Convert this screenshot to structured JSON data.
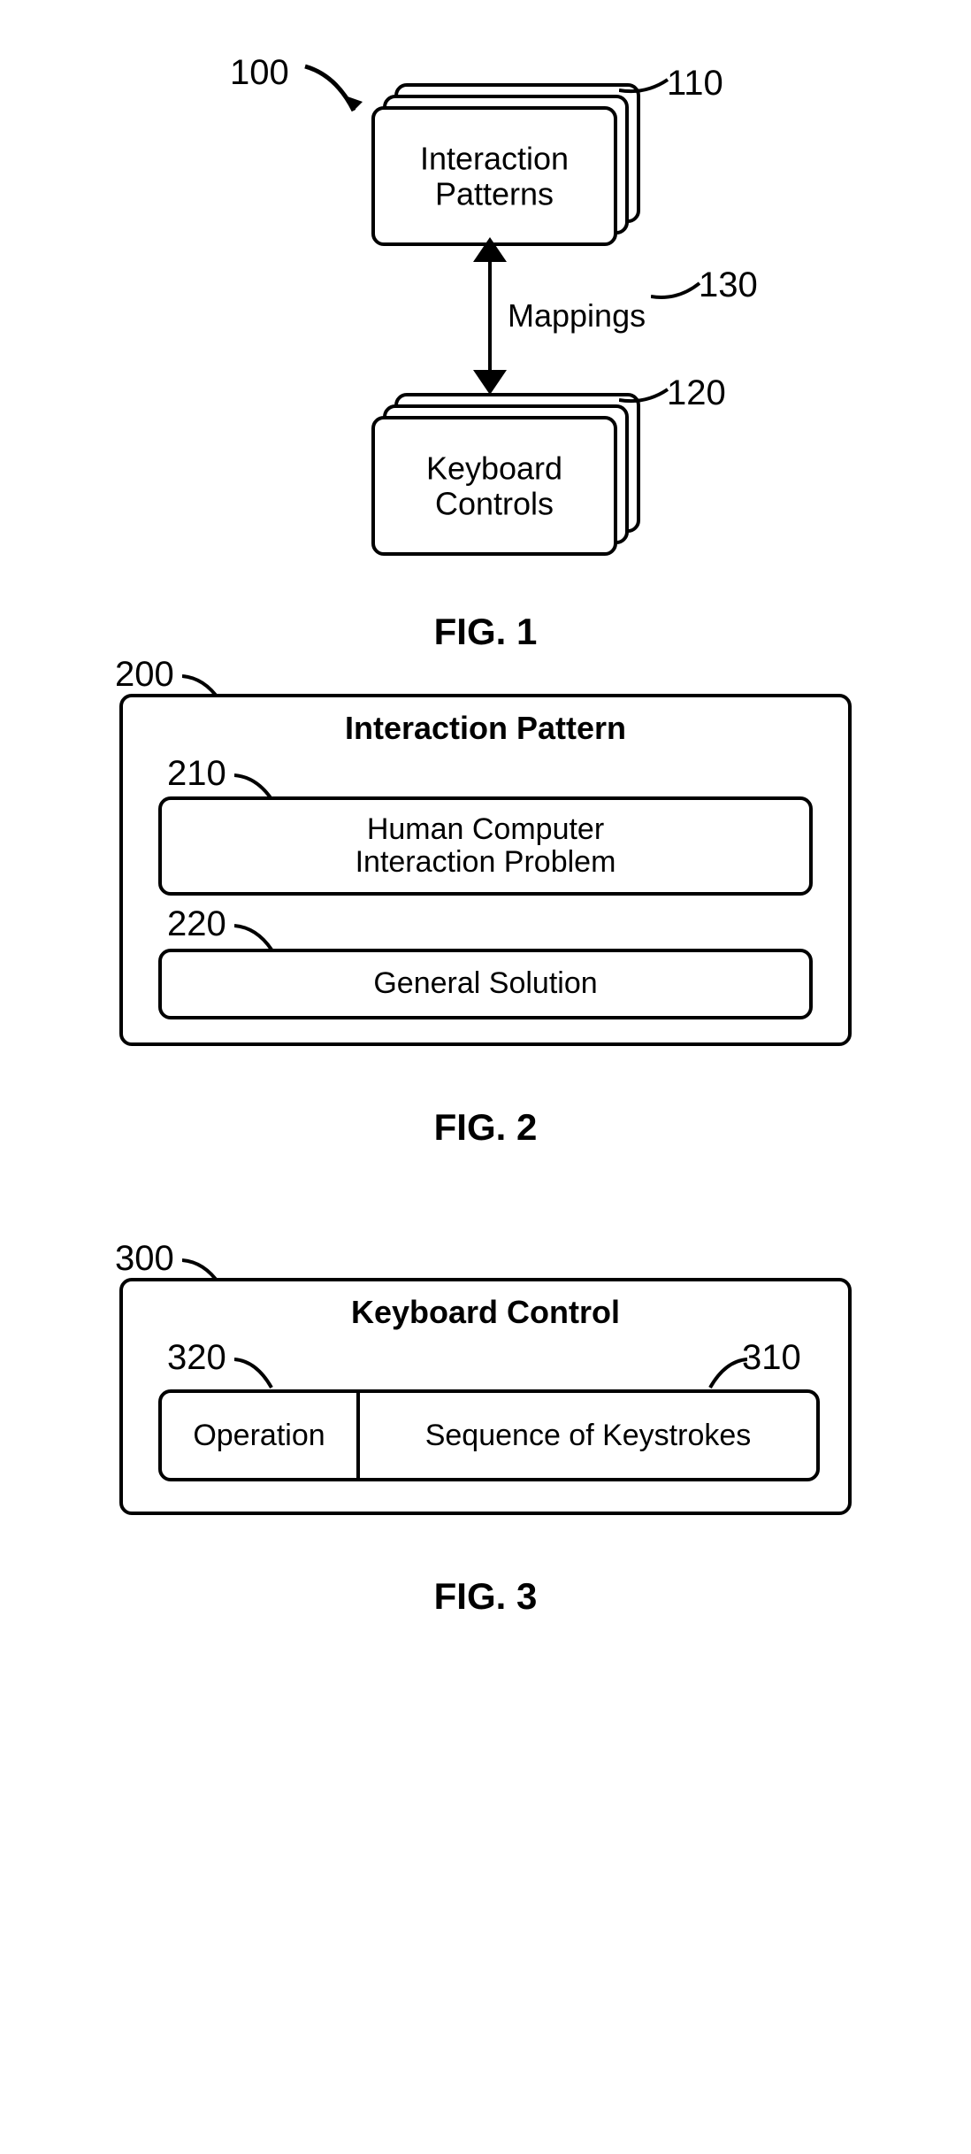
{
  "fig1": {
    "ref_100": "100",
    "ref_110": "110",
    "ref_120": "120",
    "ref_130": "130",
    "mappings_label": "Mappings",
    "box_top": "Interaction\nPatterns",
    "box_bottom": "Keyboard\nControls",
    "label": "FIG. 1"
  },
  "fig2": {
    "ref_200": "200",
    "ref_210": "210",
    "ref_220": "220",
    "title": "Interaction Pattern",
    "box1": "Human Computer\nInteraction Problem",
    "box2": "General Solution",
    "label": "FIG. 2"
  },
  "fig3": {
    "ref_300": "300",
    "ref_310": "310",
    "ref_320": "320",
    "title": "Keyboard Control",
    "cell_left": "Operation",
    "cell_right": "Sequence of Keystrokes",
    "label": "FIG. 3"
  }
}
